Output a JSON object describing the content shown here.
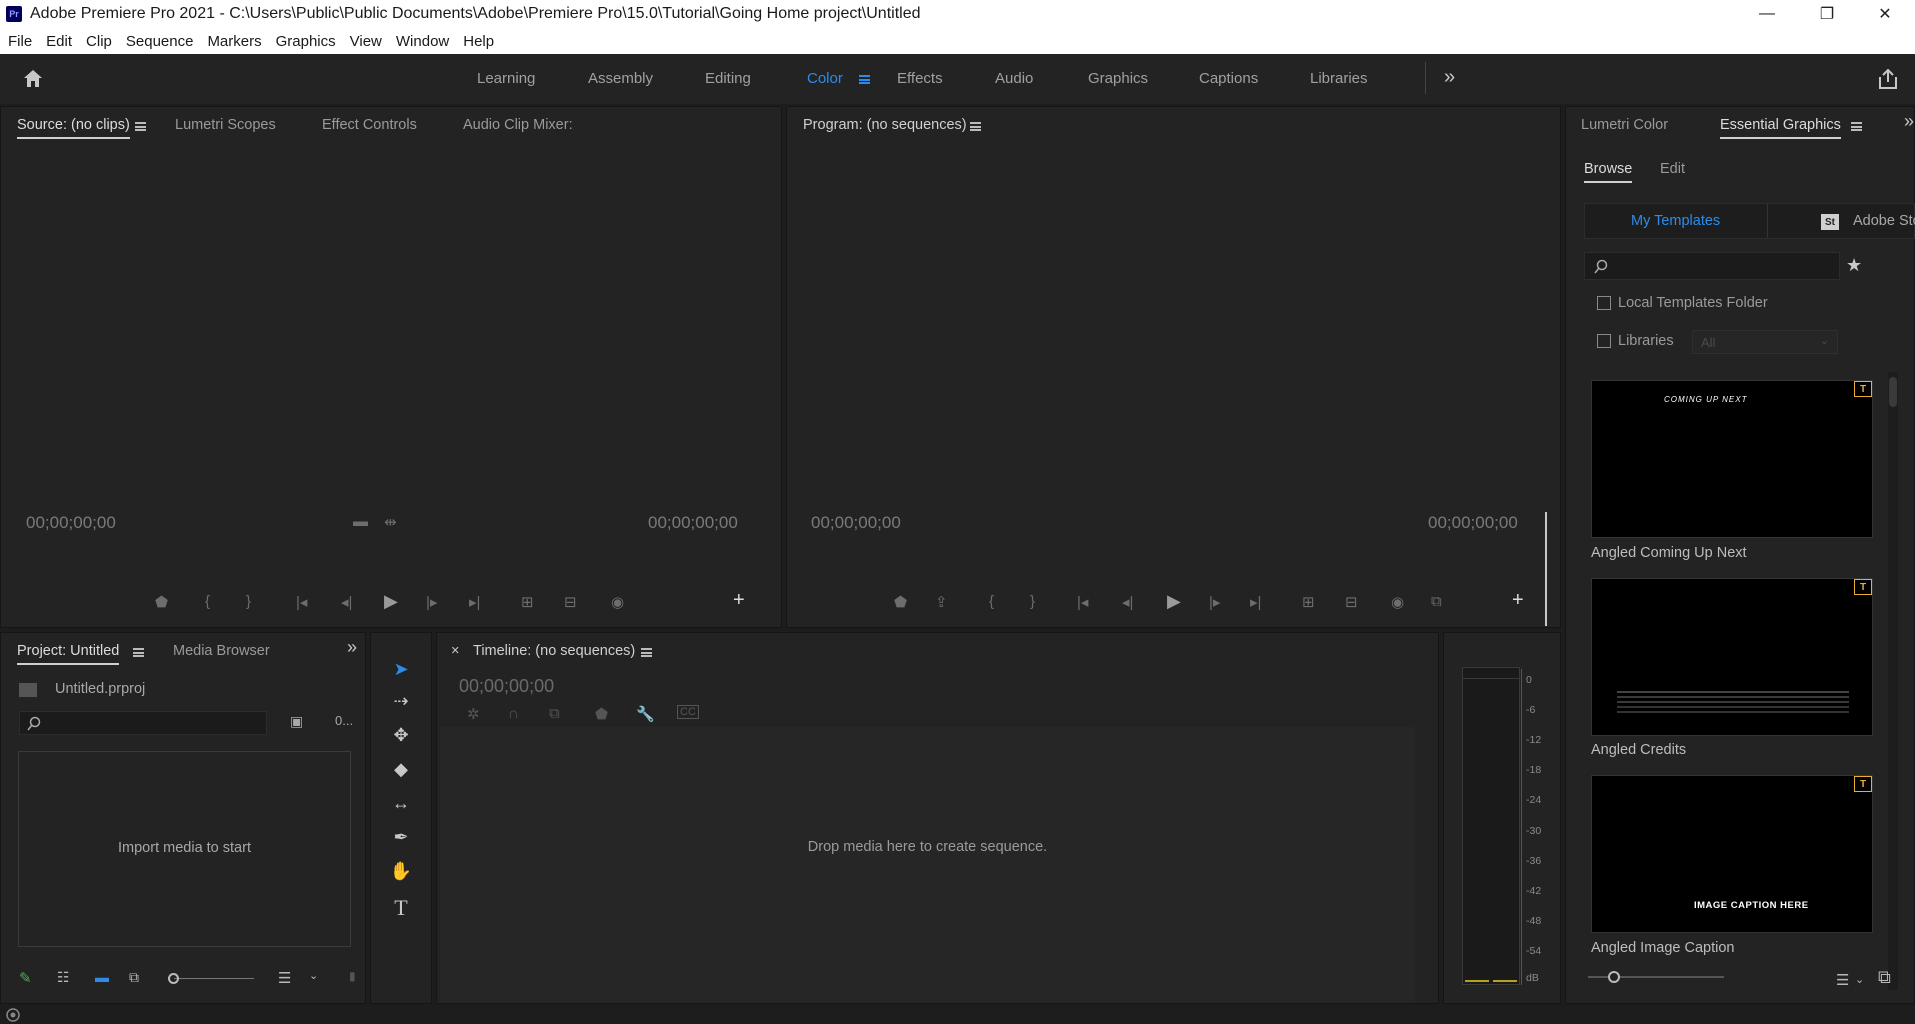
{
  "titlebar": {
    "app_badge": "Pr",
    "title": "Adobe Premiere Pro 2021 - C:\\Users\\Public\\Public Documents\\Adobe\\Premiere Pro\\15.0\\Tutorial\\Going Home project\\Untitled",
    "minimize": "—",
    "restore": "❐",
    "close": "✕"
  },
  "menu": [
    "File",
    "Edit",
    "Clip",
    "Sequence",
    "Markers",
    "Graphics",
    "View",
    "Window",
    "Help"
  ],
  "workspaces": [
    "Learning",
    "Assembly",
    "Editing",
    "Color",
    "Effects",
    "Audio",
    "Graphics",
    "Captions",
    "Libraries"
  ],
  "active_workspace": "Color",
  "source_panel": {
    "tabs": [
      "Source: (no clips)",
      "Lumetri Scopes",
      "Effect Controls",
      "Audio Clip Mixer:"
    ],
    "timecode_left": "00;00;00;00",
    "timecode_right": "00;00;00;00"
  },
  "program_panel": {
    "tab": "Program: (no sequences)",
    "timecode_left": "00;00;00;00",
    "timecode_right": "00;00;00;00"
  },
  "project_panel": {
    "tabs": [
      "Project: Untitled",
      "Media Browser"
    ],
    "file": "Untitled.prproj",
    "item_count": "0...",
    "empty_message": "Import media to start"
  },
  "timeline_panel": {
    "tab": "Timeline: (no sequences)",
    "close": "×",
    "timecode": "00;00;00;00",
    "empty_message": "Drop media here to create sequence."
  },
  "audio_meter": {
    "labels": [
      "0",
      "-6",
      "-12",
      "-18",
      "-24",
      "-30",
      "-36",
      "-42",
      "-48",
      "-54",
      "dB"
    ]
  },
  "essential_graphics": {
    "tabs": [
      "Lumetri Color",
      "Essential Graphics"
    ],
    "subtabs": [
      "Browse",
      "Edit"
    ],
    "source_tabs": [
      "My Templates",
      "Adobe Sto"
    ],
    "stock_badge": "St",
    "local_templates_label": "Local Templates Folder",
    "libraries_label": "Libraries",
    "libraries_dropdown": "All",
    "templates": [
      {
        "name": "Angled Coming Up Next",
        "preview_text": "COMING UP NEXT"
      },
      {
        "name": "Angled Credits",
        "preview_text": ""
      },
      {
        "name": "Angled Image Caption",
        "preview_text": "IMAGE CAPTION HERE"
      }
    ],
    "warn_badge": "T"
  },
  "colors": {
    "accent": "#2d8ceb",
    "panel_bg": "#232323",
    "warning": "#e8b02e"
  }
}
